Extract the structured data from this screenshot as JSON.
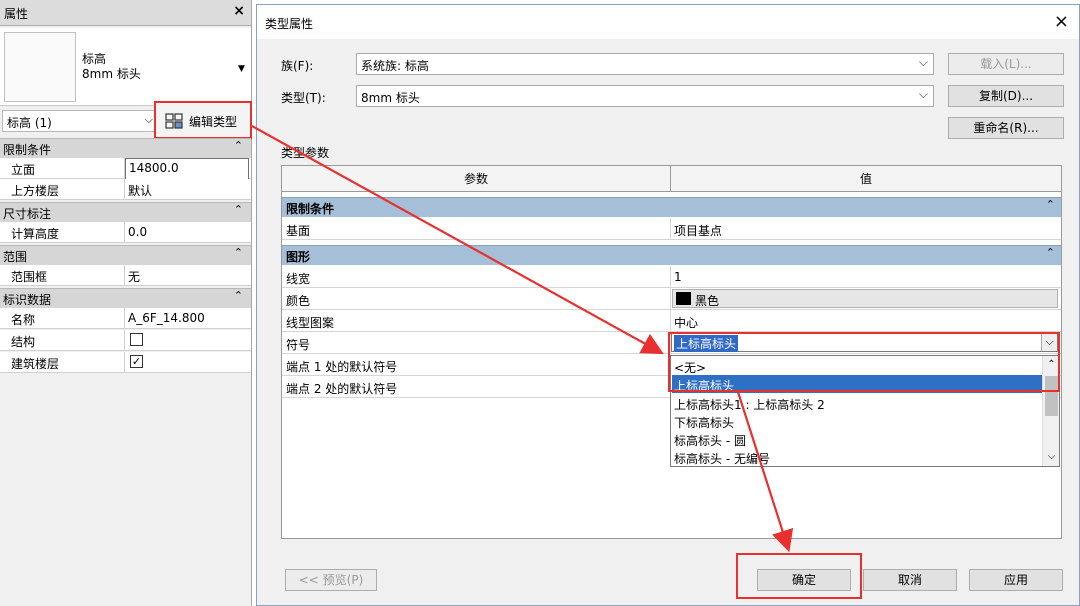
{
  "properties_panel": {
    "title": "属性",
    "close": "×",
    "type_name_line1": "标高",
    "type_name_line2": "8mm 标头",
    "instance_selector": "标高 (1)",
    "edit_type_button": "编辑类型",
    "sections": [
      {
        "label": "限制条件",
        "rows": [
          {
            "label": "立面",
            "value": "14800.0"
          },
          {
            "label": "上方楼层",
            "value": "默认"
          }
        ]
      },
      {
        "label": "尺寸标注",
        "rows": [
          {
            "label": "计算高度",
            "value": "0.0"
          }
        ]
      },
      {
        "label": "范围",
        "rows": [
          {
            "label": "范围框",
            "value": "无"
          }
        ]
      },
      {
        "label": "标识数据",
        "rows": [
          {
            "label": "名称",
            "value": "A_6F_14.800"
          },
          {
            "label": "结构",
            "checked": false
          },
          {
            "label": "建筑楼层",
            "checked": true
          }
        ]
      }
    ]
  },
  "dialog": {
    "title": "类型属性",
    "close": "×",
    "family_label": "族(F):",
    "family_value": "系统族: 标高",
    "type_label": "类型(T):",
    "type_value": "8mm 标头",
    "load_button": "载入(L)...",
    "duplicate_button": "复制(D)...",
    "rename_button": "重命名(R)...",
    "type_params_label": "类型参数",
    "columns": [
      "参数",
      "值"
    ],
    "sec_constraints": "限制条件",
    "row_base": {
      "label": "基面",
      "value": "项目基点"
    },
    "sec_graphics": "图形",
    "row_lineweight": {
      "label": "线宽",
      "value": "1"
    },
    "row_color": {
      "label": "颜色",
      "value": "黑色"
    },
    "row_linepattern": {
      "label": "线型图案",
      "value": "中心"
    },
    "row_symbol": {
      "label": "符号",
      "value": "上标高标头"
    },
    "row_end1": {
      "label": "端点 1 处的默认符号"
    },
    "row_end2": {
      "label": "端点 2 处的默认符号"
    },
    "dropdown_options": [
      "<无>",
      "上标高标头",
      "上标高标头1 : 上标高标头 2",
      "下标高标头",
      "标高标头 - 圆",
      "标高标头 - 无编号"
    ],
    "preview_button": "<< 预览(P)",
    "ok_button": "确定",
    "cancel_button": "取消",
    "apply_button": "应用"
  },
  "colors": {
    "accent_red": "#e8312f",
    "section_blue": "#a5bfd9",
    "highlight_blue": "#2f6fc4"
  }
}
